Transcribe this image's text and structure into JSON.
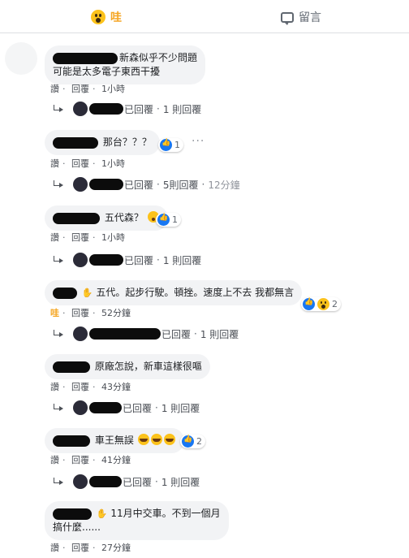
{
  "topbar": {
    "wow_label": "哇",
    "comment_label": "留言"
  },
  "comments": [
    {
      "text_lines": [
        "新森似乎不少問題",
        "可能是太多電子東西干擾"
      ],
      "actions": {
        "like": "讚",
        "reply": "回覆",
        "time": "1小時"
      },
      "reply": {
        "text": "已回覆",
        "count": "1 則回覆"
      }
    },
    {
      "text_lines": [
        "那台？？？"
      ],
      "reaction_count": "1",
      "actions": {
        "like": "讚",
        "reply": "回覆",
        "time": "1小時"
      },
      "reply": {
        "text": "已回覆",
        "count": "5則回覆",
        "time": "12分鐘"
      }
    },
    {
      "text_lines": [
        "五代森？"
      ],
      "reaction_count": "1",
      "actions": {
        "like": "讚",
        "reply": "回覆",
        "time": "1小時"
      },
      "reply": {
        "text": "已回覆",
        "count": "1 則回覆"
      }
    },
    {
      "text_lines": [
        "五代。起步行駛。頓挫。速度上不去 我都無言"
      ],
      "reaction_count": "2",
      "actions": {
        "like": "哇",
        "reply": "回覆",
        "time": "52分鐘"
      },
      "reply": {
        "text": "已回覆",
        "count": "1 則回覆"
      }
    },
    {
      "text_lines": [
        "原廠怎說，新車這樣很嘔"
      ],
      "actions": {
        "like": "讚",
        "reply": "回覆",
        "time": "43分鐘"
      },
      "reply": {
        "text": "已回覆",
        "count": "1 則回覆"
      }
    },
    {
      "text_lines": [
        "車王無誤"
      ],
      "reaction_count": "2",
      "actions": {
        "like": "讚",
        "reply": "回覆",
        "time": "41分鐘"
      },
      "reply": {
        "text": "已回覆",
        "count": "1 則回覆"
      }
    },
    {
      "text_lines": [
        "11月中交車。不到一個月",
        "搞什麼......"
      ],
      "actions": {
        "like": "讚",
        "reply": "回覆",
        "time": "27分鐘"
      }
    }
  ],
  "separator": "·",
  "more_dots": "···",
  "colors": {
    "wow": "#f5a623",
    "like": "#1877f2",
    "bubble": "#f2f3f5"
  },
  "icons": [
    "wow-reaction-icon",
    "comment-bubble-icon",
    "like-reaction-icon",
    "reply-arrow-icon",
    "avatar"
  ]
}
